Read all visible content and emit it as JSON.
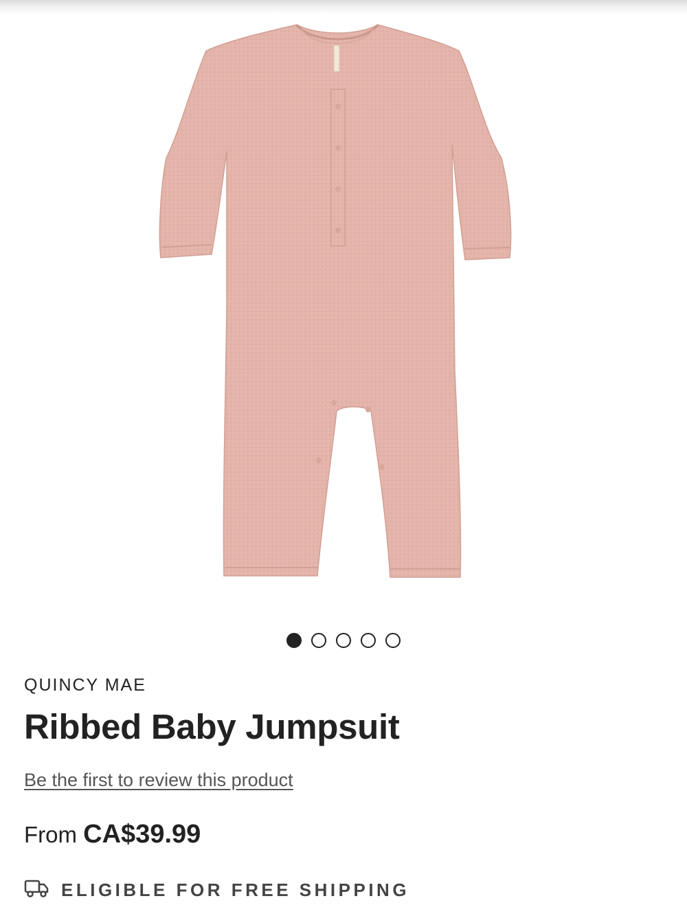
{
  "product": {
    "brand": "QUINCY MAE",
    "title": "Ribbed Baby Jumpsuit",
    "review_link": "Be the first to review this product",
    "price_prefix": "From",
    "price": "CA$39.99",
    "image_color": "#e3b3a9"
  },
  "gallery": {
    "image_count": 5,
    "active_index": 0
  },
  "shipping": {
    "icon": "truck-icon",
    "label": "ELIGIBLE FOR FREE SHIPPING"
  }
}
